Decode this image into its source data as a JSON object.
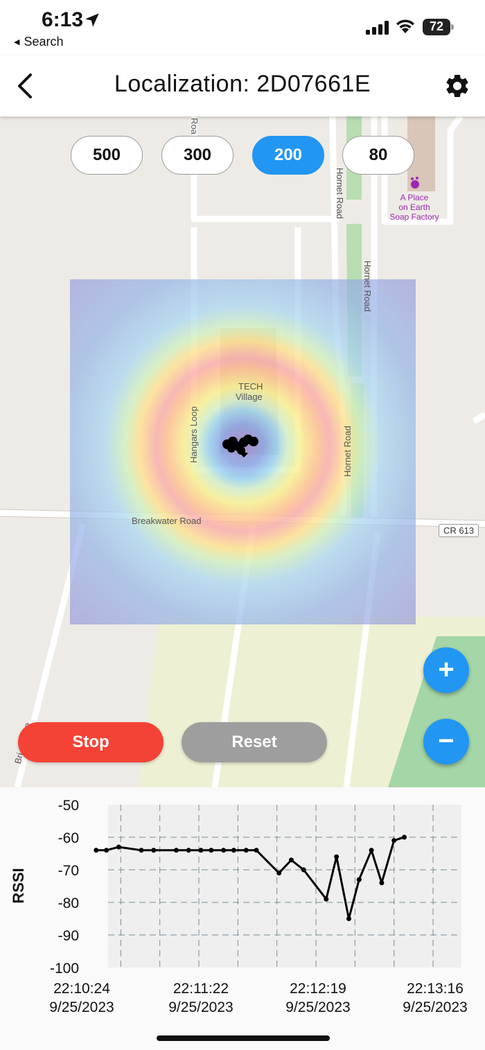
{
  "status_bar": {
    "time": "6:13",
    "back_label": "Search",
    "battery": "72"
  },
  "header": {
    "title": "Localization: 2D07661E"
  },
  "range_buttons": [
    {
      "label": "500",
      "active": false
    },
    {
      "label": "300",
      "active": false
    },
    {
      "label": "200",
      "active": true
    },
    {
      "label": "80",
      "active": false
    }
  ],
  "map": {
    "labels": {
      "hornet_road_1": "Hornet Road",
      "hornet_road_2": "Hornet Road",
      "hornet_road_3": "Hornet Road",
      "hangars_loop": "Hangars Loop",
      "breakwater": "Breakwater Road",
      "roa": "Roa",
      "drive": "Bri     d Drive",
      "cr613": "CR 613",
      "tech": "TECH",
      "village": "Village"
    },
    "poi": {
      "line1": "A Place",
      "line2": "on Earth",
      "line3": "Soap Factory"
    }
  },
  "actions": {
    "stop": "Stop",
    "reset": "Reset",
    "zoom_in": "+",
    "zoom_out": "−"
  },
  "colors": {
    "accent": "#2196f3",
    "stop": "#f44336",
    "reset": "#9e9e9e"
  },
  "chart_data": {
    "type": "line",
    "ylabel": "RSSI",
    "ylim": [
      -100,
      -50
    ],
    "y_ticks": [
      "-50",
      "-60",
      "-70",
      "-80",
      "-90",
      "-100"
    ],
    "x_ticks": [
      {
        "time": "22:10:24",
        "date": "9/25/2023"
      },
      {
        "time": "22:11:22",
        "date": "9/25/2023"
      },
      {
        "time": "22:12:19",
        "date": "9/25/2023"
      },
      {
        "time": "22:13:16",
        "date": "9/25/2023"
      }
    ],
    "grid": true,
    "series": [
      {
        "values": [
          {
            "t": "22:10:31",
            "rssi": -64
          },
          {
            "t": "22:10:36",
            "rssi": -64
          },
          {
            "t": "22:10:42",
            "rssi": -63
          },
          {
            "t": "22:10:53",
            "rssi": -64
          },
          {
            "t": "22:10:59",
            "rssi": -64
          },
          {
            "t": "22:11:10",
            "rssi": -64
          },
          {
            "t": "22:11:16",
            "rssi": -64
          },
          {
            "t": "22:11:22",
            "rssi": -64
          },
          {
            "t": "22:11:27",
            "rssi": -64
          },
          {
            "t": "22:11:33",
            "rssi": -64
          },
          {
            "t": "22:11:38",
            "rssi": -64
          },
          {
            "t": "22:11:44",
            "rssi": -64
          },
          {
            "t": "22:11:49",
            "rssi": -64
          },
          {
            "t": "22:12:00",
            "rssi": -71
          },
          {
            "t": "22:12:06",
            "rssi": -67
          },
          {
            "t": "22:12:12",
            "rssi": -70
          },
          {
            "t": "22:12:23",
            "rssi": -79
          },
          {
            "t": "22:12:28",
            "rssi": -66
          },
          {
            "t": "22:12:34",
            "rssi": -85
          },
          {
            "t": "22:12:39",
            "rssi": -73
          },
          {
            "t": "22:12:45",
            "rssi": -64
          },
          {
            "t": "22:12:50",
            "rssi": -74
          },
          {
            "t": "22:12:56",
            "rssi": -61
          },
          {
            "t": "22:13:01",
            "rssi": -60
          }
        ]
      }
    ]
  }
}
